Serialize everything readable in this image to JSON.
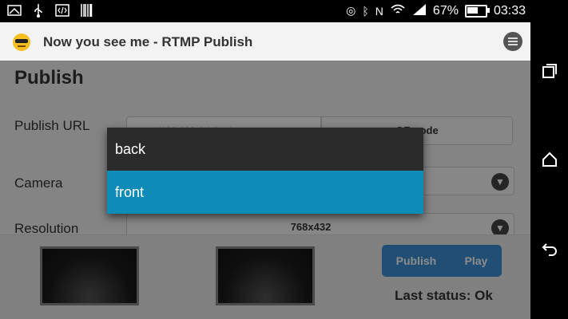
{
  "status_bar": {
    "battery_percent": "67%",
    "battery_level": 0.67,
    "time": "03:33",
    "left_icons": [
      "image-icon",
      "usb-icon",
      "code-icon",
      "barcode-icon"
    ],
    "right_icons": [
      "location-icon",
      "bluetooth-icon",
      "nfc-icon",
      "wifi-icon",
      "signal-icon",
      "battery-icon"
    ]
  },
  "app_bar": {
    "title": "Now you see me - RTMP Publish"
  },
  "page": {
    "title": "Publish",
    "publish_url_label": "Publish URL",
    "publish_url_value": "rtmp://192.168.1.1/live/stream",
    "qr_button_label": "QR code",
    "camera_label": "Camera",
    "resolution_label": "Resolution",
    "resolution_value": "768x432"
  },
  "bottom": {
    "publish_label": "Publish",
    "play_label": "Play",
    "status_text": "Last status: Ok"
  },
  "dropdown": {
    "options": [
      {
        "label": "back",
        "selected": false
      },
      {
        "label": "front",
        "selected": true
      }
    ]
  },
  "colors": {
    "accent": "#0e8bb7",
    "button": "#3b8fd3",
    "dropdown_bg": "#2b2b2b"
  },
  "nav_bar": {
    "buttons": [
      "recent-apps-icon",
      "home-icon",
      "back-icon"
    ]
  }
}
